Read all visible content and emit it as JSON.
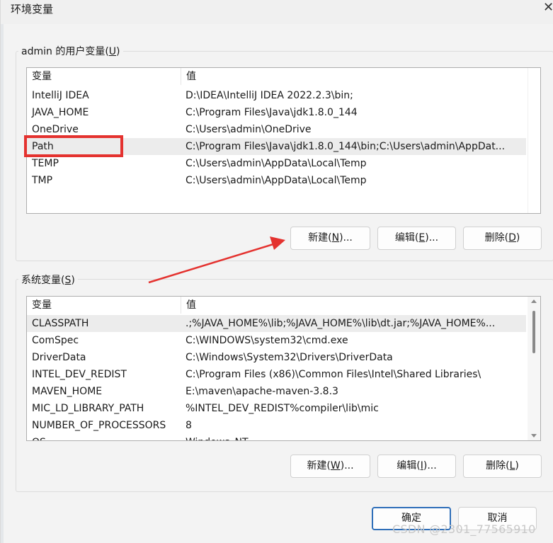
{
  "window": {
    "title": "环境变量"
  },
  "user_group": {
    "label": "admin 的用户变量(",
    "accel": "U",
    "label_suffix": ")",
    "columns": {
      "name": "变量",
      "value": "值"
    },
    "rows": [
      {
        "name": "IntelliJ IDEA",
        "value": "D:\\IDEA\\IntelliJ IDEA 2022.2.3\\bin;"
      },
      {
        "name": "JAVA_HOME",
        "value": "C:\\Program Files\\Java\\jdk1.8.0_144"
      },
      {
        "name": "OneDrive",
        "value": "C:\\Users\\admin\\OneDrive"
      },
      {
        "name": "Path",
        "value": "C:\\Program Files\\Java\\jdk1.8.0_144\\bin;C:\\Users\\admin\\AppDat..."
      },
      {
        "name": "TEMP",
        "value": "C:\\Users\\admin\\AppData\\Local\\Temp"
      },
      {
        "name": "TMP",
        "value": "C:\\Users\\admin\\AppData\\Local\\Temp"
      }
    ],
    "buttons": {
      "new": {
        "pre": "新建(",
        "accel": "N",
        "post": ")..."
      },
      "edit": {
        "pre": "编辑(",
        "accel": "E",
        "post": ")..."
      },
      "delete": {
        "pre": "删除(",
        "accel": "D",
        "post": ")"
      }
    }
  },
  "system_group": {
    "label": "系统变量(",
    "accel": "S",
    "label_suffix": ")",
    "columns": {
      "name": "变量",
      "value": "值"
    },
    "rows": [
      {
        "name": "CLASSPATH",
        "value": ".;%JAVA_HOME%\\lib;%JAVA_HOME%\\lib\\dt.jar;%JAVA_HOME%..."
      },
      {
        "name": "ComSpec",
        "value": "C:\\WINDOWS\\system32\\cmd.exe"
      },
      {
        "name": "DriverData",
        "value": "C:\\Windows\\System32\\Drivers\\DriverData"
      },
      {
        "name": "INTEL_DEV_REDIST",
        "value": "C:\\Program Files (x86)\\Common Files\\Intel\\Shared Libraries\\"
      },
      {
        "name": "MAVEN_HOME",
        "value": "E:\\maven\\apache-maven-3.8.3"
      },
      {
        "name": "MIC_LD_LIBRARY_PATH",
        "value": "%INTEL_DEV_REDIST%compiler\\lib\\mic"
      },
      {
        "name": "NUMBER_OF_PROCESSORS",
        "value": "8"
      },
      {
        "name": "OS",
        "value": "Windows_NT"
      }
    ],
    "buttons": {
      "new": {
        "pre": "新建(",
        "accel": "W",
        "post": ")..."
      },
      "edit": {
        "pre": "编辑(",
        "accel": "I",
        "post": ")..."
      },
      "delete": {
        "pre": "删除(",
        "accel": "L",
        "post": ")"
      }
    }
  },
  "footer": {
    "ok": "确定",
    "cancel": "取消"
  },
  "watermark": "CSDN @2301_77565910",
  "colors": {
    "annotation": "#e4322f",
    "primary_border": "#2f6fb9"
  }
}
